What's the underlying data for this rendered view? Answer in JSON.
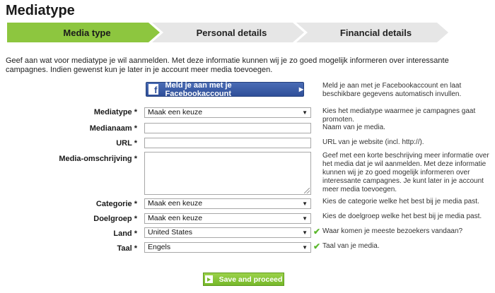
{
  "page": {
    "title": "Mediatype"
  },
  "steps": [
    {
      "label": "Media type",
      "active": true
    },
    {
      "label": "Personal details",
      "active": false
    },
    {
      "label": "Financial details",
      "active": false
    }
  ],
  "intro": "Geef aan wat voor mediatype je wil aanmelden. Met deze informatie kunnen wij je zo goed mogelijk informeren over interessante campagnes. Indien gewenst kun je later in je account meer media toevoegen.",
  "facebook": {
    "icon": "f",
    "label": "Meld je aan met je Facebookaccount",
    "help": "Meld je aan met je Facebookaccount en laat beschikbare gegevens automatisch invullen."
  },
  "fields": {
    "mediatype": {
      "label": "Mediatype",
      "value": "Maak een keuze",
      "help": "Kies het mediatype waarmee je campagnes gaat promoten."
    },
    "medianaam": {
      "label": "Medianaam",
      "value": "",
      "help": "Naam van je media."
    },
    "url": {
      "label": "URL",
      "value": "",
      "help": "URL van je website (incl. http://)."
    },
    "omschrijving": {
      "label": "Media-omschrijving",
      "value": "",
      "help": "Geef met een korte beschrijving meer informatie over het media dat je wil aanmelden. Met deze informatie kunnen wij je zo goed mogelijk informeren over interessante campagnes. Je kunt later in je account meer media toevoegen."
    },
    "categorie": {
      "label": "Categorie",
      "value": "Maak een keuze",
      "help": "Kies de categorie welke het best bij je media past."
    },
    "doelgroep": {
      "label": "Doelgroep",
      "value": "Maak een keuze",
      "help": "Kies de doelgroep welke het best bij je media past."
    },
    "land": {
      "label": "Land",
      "value": "United States",
      "help": "Waar komen je meeste bezoekers vandaan?"
    },
    "taal": {
      "label": "Taal",
      "value": "Engels",
      "help": "Taal van je media."
    }
  },
  "required_mark": "*",
  "check_glyph": "✔",
  "dropdown_glyph": "▼",
  "save_label": "Save and proceed",
  "colors": {
    "accent": "#8dc63f",
    "facebook": "#3b5998",
    "check": "#5cb82e"
  }
}
